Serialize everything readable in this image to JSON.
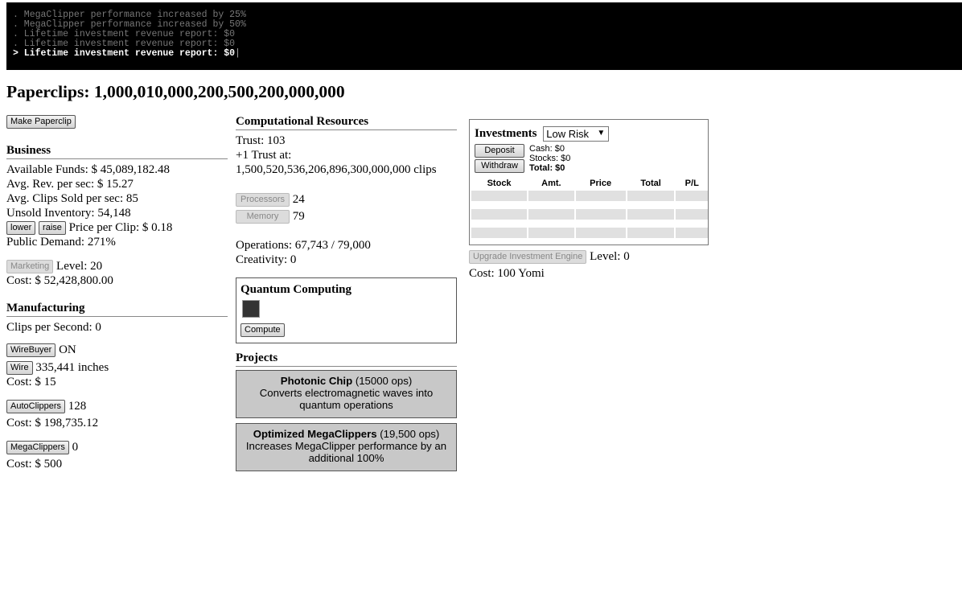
{
  "console": {
    "lines": [
      ". MegaClipper performance increased by 25%",
      ". MegaClipper performance increased by 50%",
      ". Lifetime investment revenue report: $0",
      ". Lifetime investment revenue report: $0"
    ],
    "current": "> Lifetime investment revenue report: $0",
    "cursor": "|"
  },
  "title": "Paperclips: 1,000,010,000,200,500,200,000,000",
  "left": {
    "make_button": "Make Paperclip",
    "business": {
      "heading": "Business",
      "funds": "Available Funds: $ 45,089,182.48",
      "rev": "Avg. Rev. per sec: $ 15.27",
      "sold": "Avg. Clips Sold per sec: 85",
      "unsold": "Unsold Inventory: 54,148",
      "lower": "lower",
      "raise": "raise",
      "price": "Price per Clip: $ 0.18",
      "demand": "Public Demand: 271%",
      "marketing_button": "Marketing",
      "marketing_level": "Level: 20",
      "marketing_cost": "Cost: $ 52,428,800.00"
    },
    "manufacturing": {
      "heading": "Manufacturing",
      "cps": "Clips per Second: 0",
      "wirebuyer_button": "WireBuyer",
      "wirebuyer_status": "ON",
      "wire_button": "Wire",
      "wire_amount": "335,441 inches",
      "wire_cost": "Cost: $ 15",
      "autoclippers_button": "AutoClippers",
      "autoclippers_count": "128",
      "autoclippers_cost": "Cost: $ 198,735.12",
      "megaclippers_button": "MegaClippers",
      "megaclippers_count": "0",
      "megaclippers_cost": "Cost: $ 500"
    }
  },
  "middle": {
    "heading": "Computational Resources",
    "trust": "Trust: 103",
    "trust_next": "+1 Trust at:",
    "trust_clips": "1,500,520,536,206,896,300,000,000 clips",
    "processors_button": "Processors",
    "processors_value": "24",
    "memory_button": "Memory",
    "memory_value": "79",
    "operations": "Operations: 67,743 / 79,000",
    "creativity": "Creativity: 0",
    "quantum": {
      "title": "Quantum Computing",
      "compute_button": "Compute"
    },
    "projects_heading": "Projects",
    "projects": [
      {
        "name": "Photonic Chip",
        "cost": "(15000 ops)",
        "desc": "Converts electromagnetic waves into quantum operations"
      },
      {
        "name": "Optimized MegaClippers",
        "cost": "(19,500 ops)",
        "desc": "Increases MegaClipper performance by an additional 100%"
      }
    ]
  },
  "right": {
    "heading": "Investments",
    "risk": "Low Risk",
    "deposit": "Deposit",
    "withdraw": "Withdraw",
    "cash": "Cash: $0",
    "stocks": "Stocks: $0",
    "total": "Total: $0",
    "columns": [
      "Stock",
      "Amt.",
      "Price",
      "Total",
      "P/L"
    ],
    "upgrade_button": "Upgrade Investment Engine",
    "upgrade_level": "Level: 0",
    "upgrade_cost": "Cost: 100 Yomi"
  }
}
